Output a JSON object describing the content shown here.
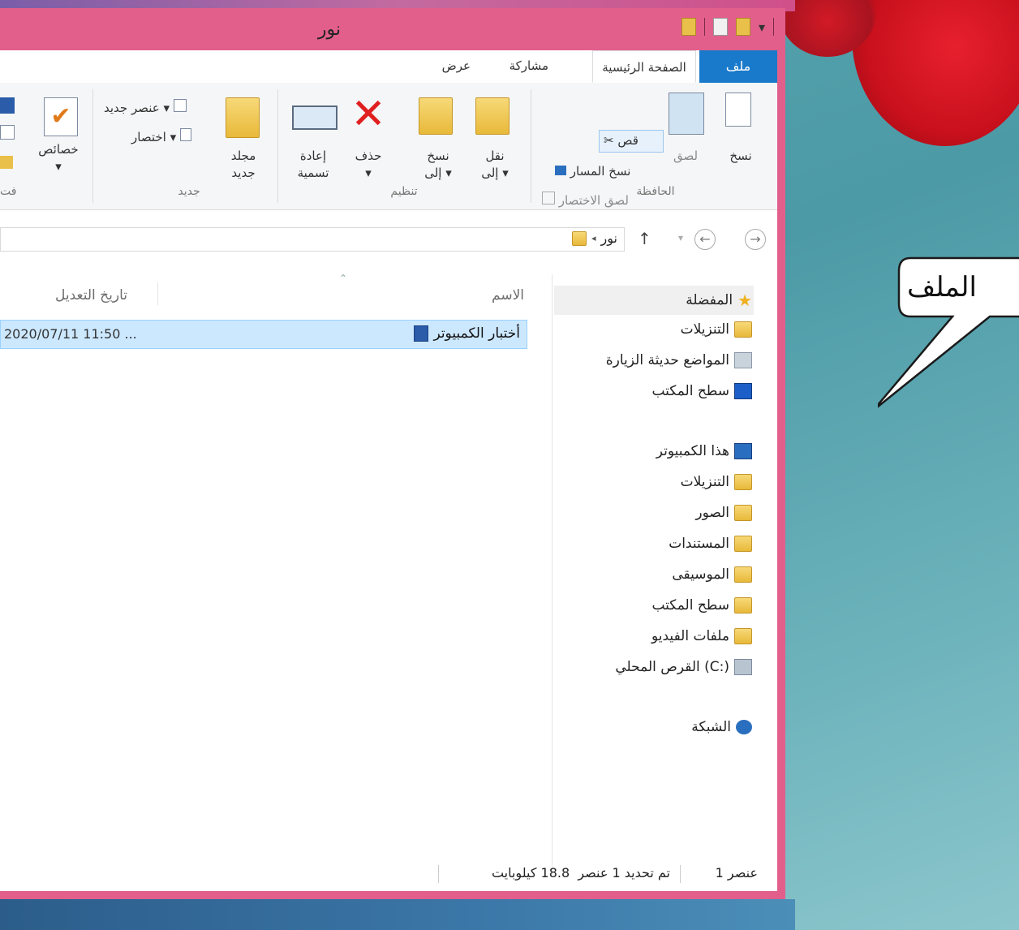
{
  "window": {
    "title": "نور"
  },
  "tabs": {
    "file": "ملف",
    "home": "الصفحة الرئيسية",
    "share": "مشاركة",
    "view": "عرض"
  },
  "ribbon": {
    "clipboard": {
      "label": "الحافظة",
      "copy": "نسخ",
      "paste": "لصق",
      "cut": "قص",
      "copy_path": "نسخ المسار",
      "paste_shortcut": "لصق الاختصار"
    },
    "organize": {
      "label": "تنظيم",
      "move_to_1": "نقل",
      "move_to_2": "إلى ▾",
      "copy_to_1": "نسخ",
      "copy_to_2": "إلى ▾",
      "delete": "حذف",
      "delete_arrow": "▾",
      "rename_1": "إعادة",
      "rename_2": "تسمية"
    },
    "new": {
      "label": "جديد",
      "new_folder_1": "مجلد",
      "new_folder_2": "جديد",
      "new_item": "عنصر جديد ▾",
      "easy_access": "اختصار ▾"
    },
    "open": {
      "properties": "خصائص",
      "properties_arrow": "▾",
      "label_partial": "فت"
    }
  },
  "address": {
    "path": "نور",
    "separator": "◂"
  },
  "columns": {
    "name": "الاسم",
    "date_modified": "تاريخ التعديل"
  },
  "files": [
    {
      "name": "أختبار الكمبيوتر",
      "date": "2020/07/11 11:50 ..."
    }
  ],
  "nav": {
    "favorites": "المفضلة",
    "downloads": "التنزيلات",
    "recent": "المواضع حديثة الزيارة",
    "desktop": "سطح المكتب",
    "this_pc": "هذا الكمبيوتر",
    "pc_downloads": "التنزيلات",
    "pictures": "الصور",
    "documents": "المستندات",
    "music": "الموسيقى",
    "pc_desktop": "سطح المكتب",
    "videos": "ملفات الفيديو",
    "local_disk": "القرص المحلي (C:)",
    "network": "الشبكة"
  },
  "status": {
    "count": "1 عنصر",
    "selection": "تم تحديد 1 عنصر  18.8 كيلوبايت"
  },
  "callout": {
    "text": "الملف"
  },
  "colors": {
    "window_frame": "#e25f8c",
    "file_tab": "#1979ca",
    "selection": "#cce8ff"
  }
}
